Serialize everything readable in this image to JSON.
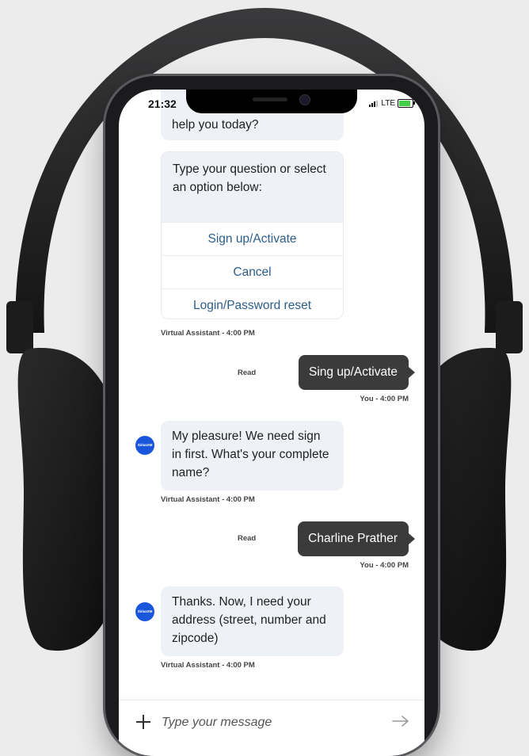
{
  "status_bar": {
    "time": "21:32",
    "network": "LTE"
  },
  "chat": {
    "partial_message": "help you today?",
    "options_card": {
      "text": "Type your question or select an option below:",
      "options": [
        "Sign up/Activate",
        "Cancel",
        "Login/Password reset"
      ],
      "meta": "Virtual Assistant - 4:00 PM"
    },
    "messages": [
      {
        "sender": "user",
        "text": "Sing up/Activate",
        "read_label": "Read",
        "meta": "You - 4:00 PM"
      },
      {
        "sender": "bot",
        "text": "My pleasure! We need sign in first. What's your complete name?",
        "meta": "Virtual Assistant - 4:00 PM",
        "avatar_text": "SiriusXM"
      },
      {
        "sender": "user",
        "text": "Charline Prather",
        "read_label": "Read",
        "meta": "You - 4:00 PM"
      },
      {
        "sender": "bot",
        "text": "Thanks. Now, I need your address (street, number and zipcode)",
        "meta": "Virtual Assistant - 4:00 PM",
        "avatar_text": "SiriusXM"
      }
    ]
  },
  "composer": {
    "placeholder": "Type your message",
    "value": ""
  },
  "colors": {
    "user_bubble": "#3b3b3b",
    "bot_bubble": "#eef1f5",
    "option_text": "#2c5d8a",
    "avatar": "#1a56db"
  }
}
